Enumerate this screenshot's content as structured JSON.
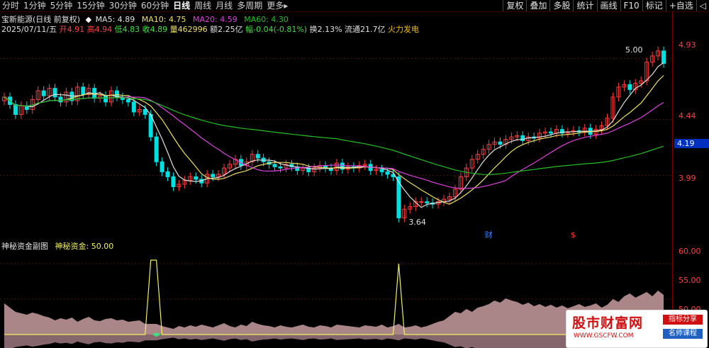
{
  "toolbar": {
    "periods": [
      "分时",
      "1分钟",
      "5分钟",
      "15分钟",
      "30分钟",
      "60分钟",
      "日线",
      "周线",
      "月线",
      "多周期",
      "更多"
    ],
    "active_period": "日线",
    "more_arrow": "▸",
    "tools": [
      "复权",
      "叠加",
      "多股",
      "统计",
      "画线",
      "F10",
      "标记",
      "+自选",
      "◁"
    ]
  },
  "header": {
    "stock_name": "宝新能源(日线 前复权)",
    "ma_icon": "◆",
    "ma5": "MA5: 4.89",
    "ma10": "MA10: 4.75",
    "ma20": "MA20: 4.59",
    "ma60": "MA60: 4.30",
    "date": "2025/07/11/五",
    "open": "开4.91",
    "high": "高4.94",
    "low": "低4.83",
    "close": "收4.89",
    "volume": "量462996",
    "amount": "额2.25亿",
    "change": "幅-0.04(-0.81%)",
    "turnover": "换2.13%",
    "float": "流通21.7亿",
    "concept": "火力发电"
  },
  "annotations": {
    "high_label": "5.00",
    "low_label": "3.64",
    "marker_cai": "财",
    "marker_dollar": "$"
  },
  "main_axis": {
    "labels": [
      "4.93",
      "4.44",
      "3.99"
    ],
    "current_price": "4.19"
  },
  "sub_panel": {
    "title": "神秘资金副图",
    "indicator_label": "神秘资金: 50.00",
    "axis": [
      "60.00",
      "55.00",
      "50.00"
    ]
  },
  "watermark": {
    "title": "股市财富网",
    "url": "WWW.GSCFW.COM",
    "tag1": "指标分享",
    "tag2": "名师课程"
  },
  "colors": {
    "bg": "#000000",
    "up": "#ff3c3c",
    "down": "#00e0e0",
    "ma5": "#e0e0e0",
    "ma10": "#f0e060",
    "ma20": "#e040e0",
    "ma60": "#20c020",
    "sub_line": "#f0f060",
    "sub_fill": "#c89ea0"
  },
  "chart_data": {
    "type": "candlestick",
    "dates_start": "",
    "closes": [
      4.62,
      4.56,
      4.48,
      4.55,
      4.52,
      4.6,
      4.67,
      4.63,
      4.69,
      4.62,
      4.58,
      4.66,
      4.59,
      4.7,
      4.64,
      4.69,
      4.61,
      4.63,
      4.58,
      4.67,
      4.62,
      4.6,
      4.58,
      4.5,
      4.52,
      4.48,
      4.3,
      4.1,
      4.02,
      3.98,
      3.9,
      3.92,
      3.95,
      3.98,
      3.96,
      3.93,
      4.0,
      3.98,
      4.0,
      4.05,
      4.08,
      4.12,
      4.07,
      4.1,
      4.16,
      4.13,
      4.1,
      4.08,
      4.06,
      4.05,
      4.08,
      4.06,
      4.03,
      4.05,
      4.02,
      4.05,
      4.07,
      4.05,
      4.03,
      4.09,
      4.04,
      4.06,
      4.05,
      4.07,
      4.08,
      4.03,
      4.04,
      4.02,
      4.0,
      3.98,
      3.65,
      3.72,
      3.74,
      3.78,
      3.78,
      3.77,
      3.76,
      3.78,
      3.8,
      3.82,
      3.88,
      3.98,
      4.05,
      4.12,
      4.16,
      4.2,
      4.24,
      4.26,
      4.24,
      4.28,
      4.3,
      4.31,
      4.27,
      4.3,
      4.29,
      4.33,
      4.34,
      4.33,
      4.36,
      4.33,
      4.34,
      4.35,
      4.34,
      4.37,
      4.32,
      4.36,
      4.39,
      4.45,
      4.62,
      4.7,
      4.72,
      4.68,
      4.73,
      4.75,
      4.9,
      4.95,
      4.99,
      4.89
    ],
    "sub_values": [
      54.4,
      53.8,
      53.2,
      53.0,
      52.8,
      53.1,
      52.9,
      52.6,
      52.4,
      52.0,
      52.3,
      52.1,
      52.4,
      51.8,
      52.2,
      52.5,
      52.0,
      51.9,
      52.2,
      52.3,
      52.0,
      52.1,
      51.8,
      51.9,
      52.0,
      51.5,
      60.5,
      60.5,
      51.2,
      51.0,
      50.8,
      51.2,
      51.0,
      51.3,
      51.1,
      51.4,
      51.2,
      51.0,
      51.3,
      51.6,
      51.2,
      51.0,
      51.4,
      51.2,
      51.8,
      51.5,
      51.3,
      51.2,
      51.0,
      51.3,
      51.1,
      51.0,
      51.2,
      51.4,
      51.1,
      51.0,
      51.3,
      51.2,
      51.0,
      51.4,
      51.3,
      51.2,
      51.1,
      51.0,
      51.3,
      51.2,
      51.1,
      51.4,
      51.0,
      51.2,
      60.0,
      51.0,
      51.1,
      51.3,
      51.0,
      51.2,
      51.5,
      51.8,
      52.0,
      52.6,
      53.2,
      53.0,
      53.6,
      53.2,
      53.8,
      54.0,
      54.3,
      54.8,
      54.5,
      55.1,
      54.8,
      54.6,
      54.2,
      54.5,
      54.0,
      54.3,
      53.9,
      54.2,
      53.8,
      54.1,
      53.7,
      54.0,
      54.3,
      53.9,
      54.1,
      54.4,
      53.8,
      54.2,
      55.0,
      54.6,
      55.4,
      55.8,
      55.2,
      55.6,
      56.0,
      55.4,
      56.2,
      55.6
    ],
    "ylim": [
      3.55,
      5.12
    ],
    "sub_ylim": [
      48.5,
      61.5
    ]
  }
}
